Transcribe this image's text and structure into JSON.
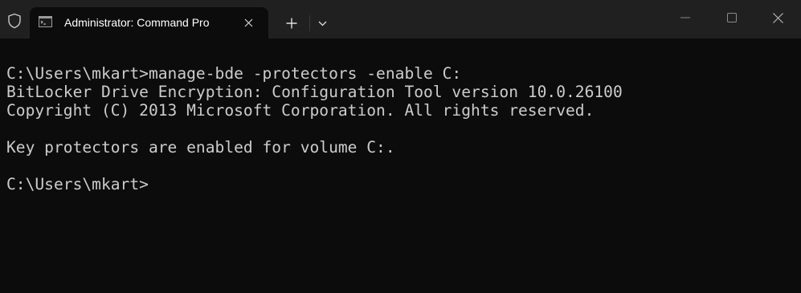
{
  "titlebar": {
    "tab_title": "Administrator: Command Pro",
    "icons": {
      "admin": "shield-icon",
      "tab": "terminal-icon",
      "tab_close": "close-icon",
      "new_tab": "plus-icon",
      "dropdown": "chevron-down-icon",
      "minimize": "minimize-icon",
      "maximize": "maximize-icon",
      "close": "close-icon"
    }
  },
  "terminal": {
    "lines": [
      "C:\\Users\\mkart>manage-bde -protectors -enable C:",
      "BitLocker Drive Encryption: Configuration Tool version 10.0.26100",
      "Copyright (C) 2013 Microsoft Corporation. All rights reserved.",
      "",
      "Key protectors are enabled for volume C:.",
      "",
      "C:\\Users\\mkart>"
    ]
  },
  "colors": {
    "titlebar_bg": "#202020",
    "terminal_bg": "#0c0c0c",
    "terminal_text": "#cccccc",
    "tab_text": "#ffffff"
  }
}
